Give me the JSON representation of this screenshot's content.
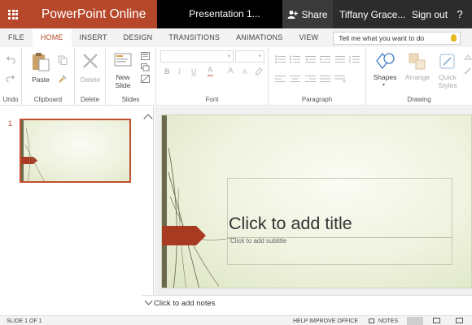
{
  "titlebar": {
    "app_name": "PowerPoint Online",
    "doc_name": "Presentation 1...",
    "share_label": "Share",
    "user_name": "Tiffany Grace...",
    "signout_label": "Sign out",
    "help_label": "?"
  },
  "tabs": [
    {
      "label": "FILE"
    },
    {
      "label": "HOME"
    },
    {
      "label": "INSERT"
    },
    {
      "label": "DESIGN"
    },
    {
      "label": "TRANSITIONS"
    },
    {
      "label": "ANIMATIONS"
    },
    {
      "label": "VIEW"
    }
  ],
  "active_tab": "HOME",
  "tellme": {
    "placeholder": "Tell me what you want to do"
  },
  "ribbon": {
    "undo": {
      "group_label": "Undo"
    },
    "clipboard": {
      "paste_label": "Paste",
      "group_label": "Clipboard"
    },
    "delete": {
      "delete_label": "Delete",
      "group_label": "Delete"
    },
    "slides": {
      "new_slide_label_1": "New",
      "new_slide_label_2": "Slide",
      "group_label": "Slides"
    },
    "font": {
      "group_label": "Font",
      "bold": "B",
      "italic": "I",
      "underline": "U",
      "color": "A",
      "grow": "A",
      "shrink": "A"
    },
    "paragraph": {
      "group_label": "Paragraph"
    },
    "drawing": {
      "shapes_label": "Shapes",
      "arrange_label": "Arrange",
      "quick_styles_label_1": "Quick",
      "quick_styles_label_2": "Styles",
      "group_label": "Drawing"
    }
  },
  "thumbnails": [
    {
      "number": "1"
    }
  ],
  "slide": {
    "title_placeholder": "Click to add title",
    "subtitle_placeholder": "Click to add subtitle"
  },
  "notes": {
    "label": "Click to add notes"
  },
  "status": {
    "slide_counter": "SLIDE 1 OF 1",
    "help_improve": "HELP IMPROVE OFFICE",
    "notes_label": "NOTES"
  },
  "colors": {
    "brand": "#b7472a",
    "slide_accent": "#a93a22",
    "slide_bar": "#6b6a4f"
  }
}
